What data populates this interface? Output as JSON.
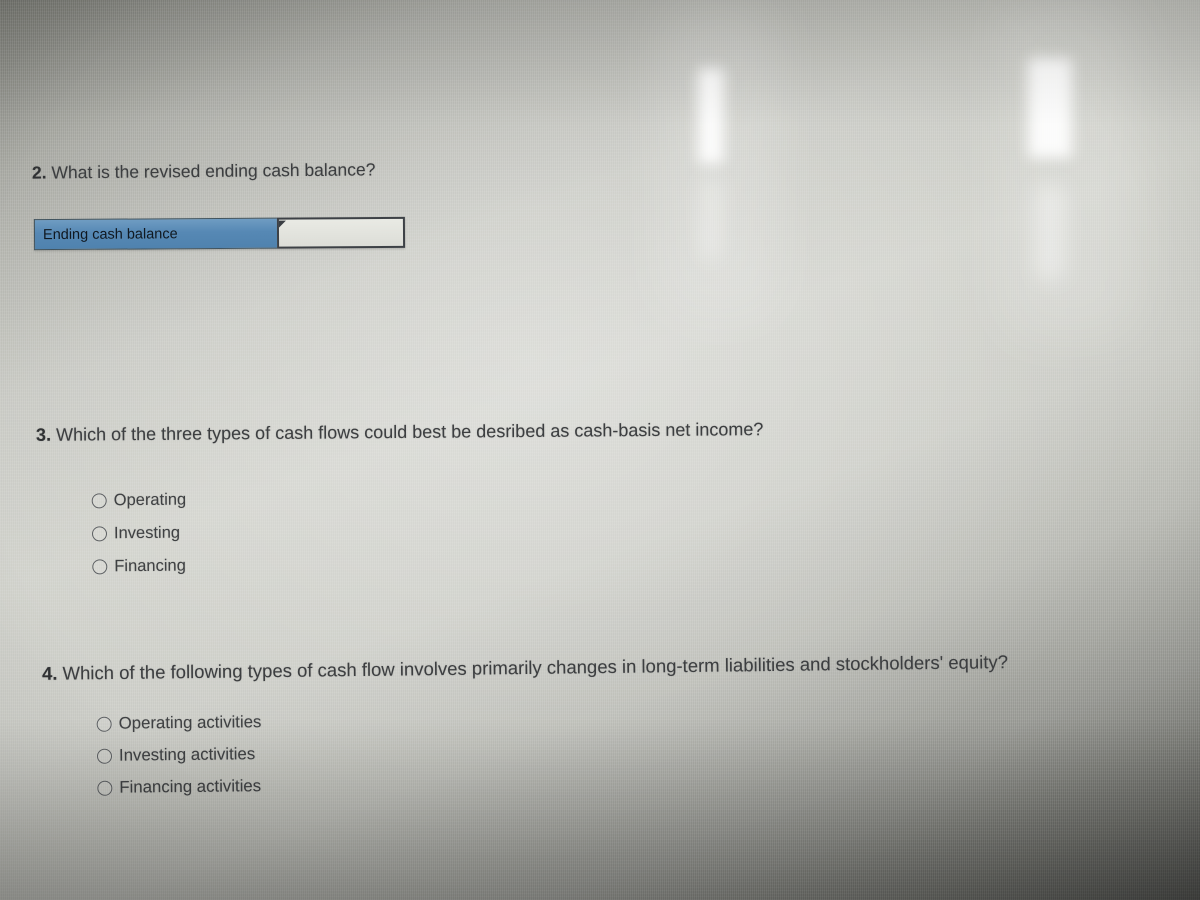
{
  "page": {
    "kind": "photo-of-screen-quiz",
    "background_colors": {
      "center_light": "#d2d3cd",
      "top_left_dark": "#83847e",
      "bottom_dark": "#555653",
      "text": "#3c3e40"
    }
  },
  "questions": [
    {
      "number": "2.",
      "text": "What is the revised ending cash balance?",
      "answer_row": {
        "label": "Ending cash balance",
        "value": "",
        "placeholder": "",
        "label_color": "#5688b4"
      }
    },
    {
      "number": "3.",
      "text": "Which of the three types of cash flows could best be desribed as cash-basis net income?",
      "options": [
        {
          "label": "Operating",
          "selected": false
        },
        {
          "label": "Investing",
          "selected": false
        },
        {
          "label": "Financing",
          "selected": false
        }
      ]
    },
    {
      "number": "4.",
      "text": "Which of the following types of cash flow involves primarily changes in long-term liabilities and stockholders' equity?",
      "options": [
        {
          "label": "Operating activities",
          "selected": false
        },
        {
          "label": "Investing activities",
          "selected": false
        },
        {
          "label": "Financing activities",
          "selected": false
        }
      ]
    }
  ]
}
